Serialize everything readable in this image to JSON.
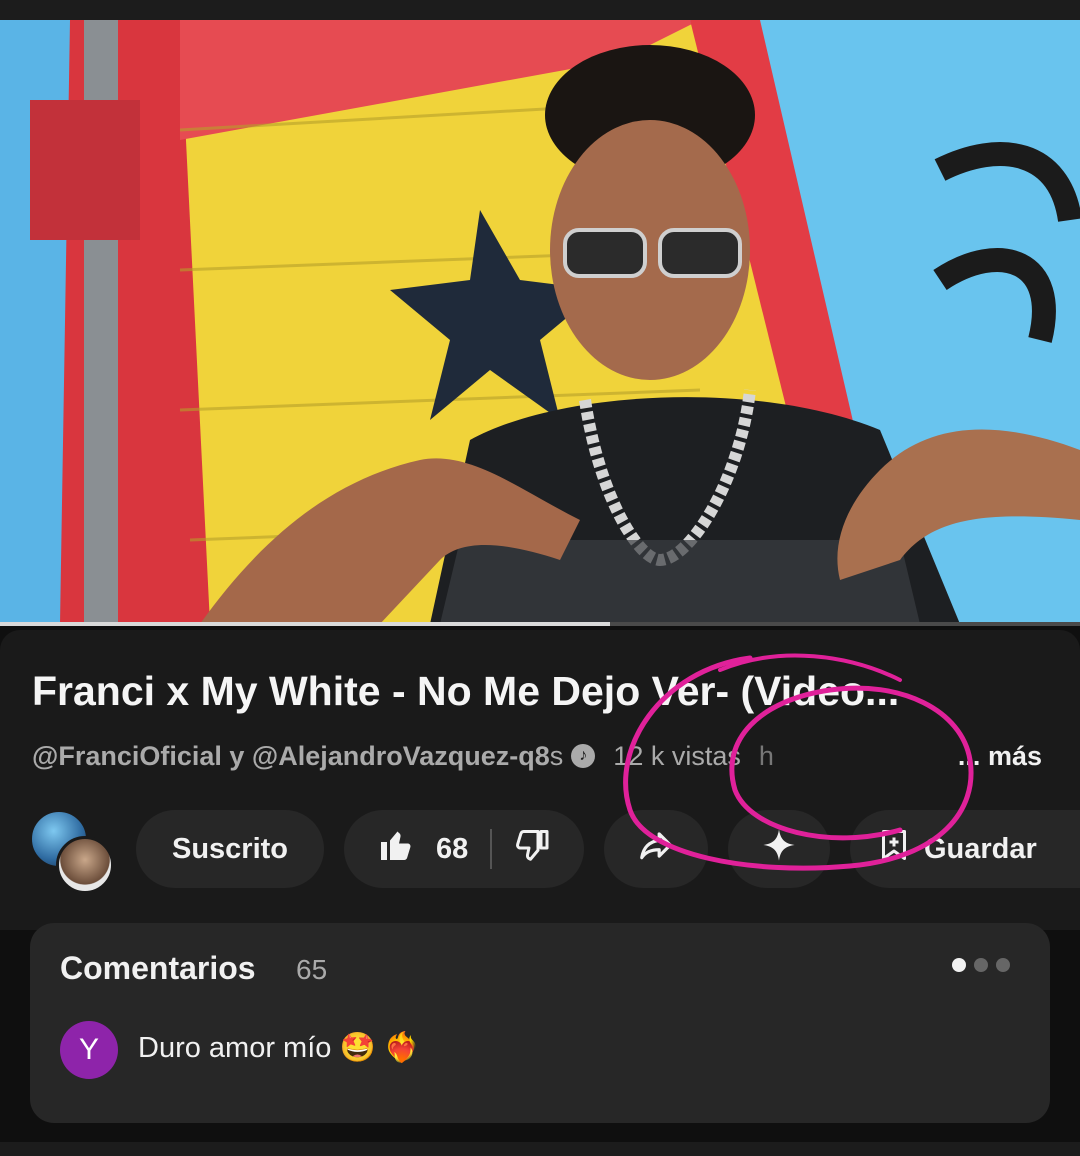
{
  "video": {
    "title": "Franci x My White - No Me Dejo Ver- (Video...",
    "channels": "@FranciOficial y @AlejandroVazquez-q8",
    "channels_suffix": "s",
    "views": "12 k vistas",
    "views_trail": "h",
    "more_dots": "...",
    "more_label": "más",
    "progress_fraction": 0.565
  },
  "actions": {
    "subscribe_label": "Suscrito",
    "like_count": "68",
    "save_label": "Guardar",
    "icons": [
      "like-icon",
      "dislike-icon",
      "share-icon",
      "sparkle-icon",
      "save-icon"
    ]
  },
  "comments": {
    "title": "Comentarios",
    "count": "65",
    "first": {
      "avatar_letter": "Y",
      "avatar_color": "#8e24aa",
      "text": "Duro amor mío 🤩 ❤️‍🔥"
    }
  },
  "colors": {
    "background": "#0f0f0f",
    "panel": "#1a1a1a",
    "pill": "#272727",
    "annotation": "#e0219a"
  }
}
